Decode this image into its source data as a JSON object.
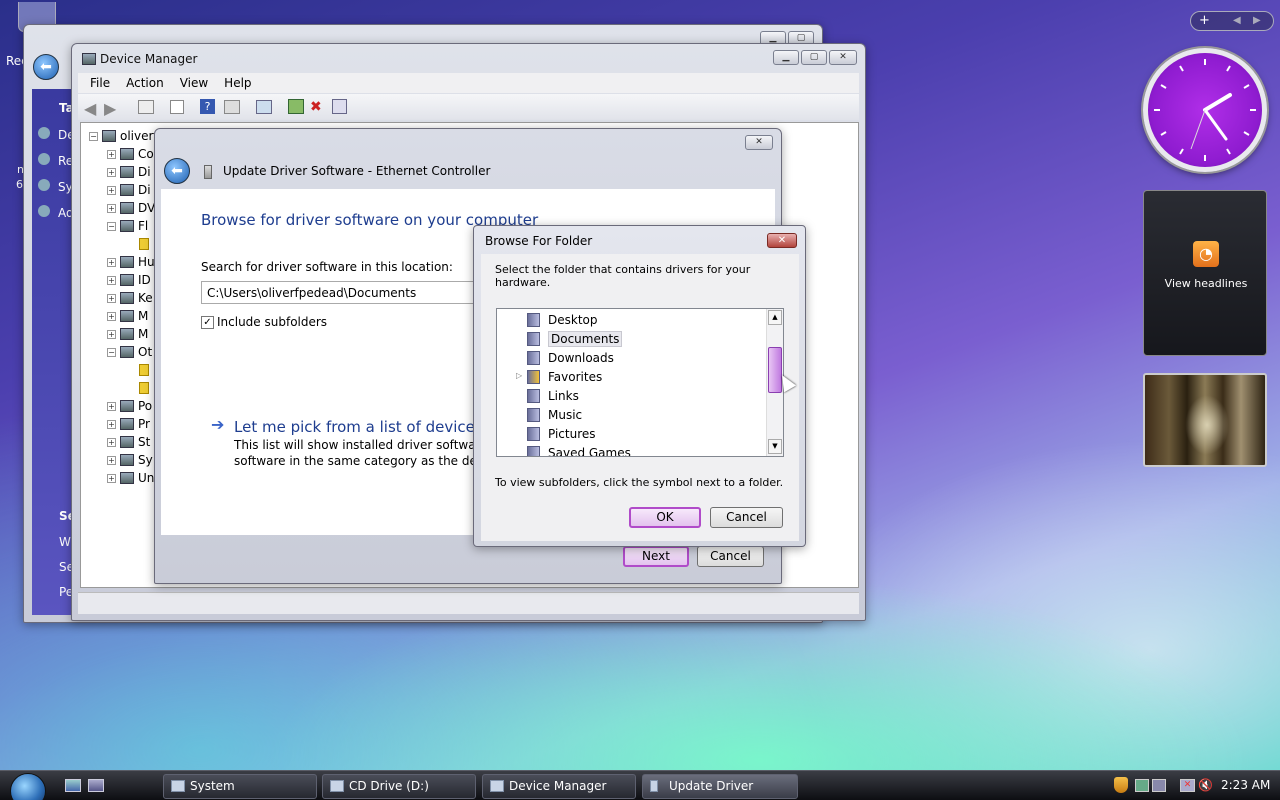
{
  "desktop": {
    "recycle_label": "Rec",
    "left_edge_text_1": "n",
    "left_edge_text_2": "6"
  },
  "system_window": {
    "tasks_heading": "Ta",
    "tasks": [
      "De",
      "Re",
      "Sy",
      "Ad"
    ],
    "see_also_heading": "Se",
    "see_also": [
      "W",
      "Se",
      "Pe"
    ]
  },
  "device_manager": {
    "title": "Device Manager",
    "menu": [
      "File",
      "Action",
      "View",
      "Help"
    ],
    "tree": {
      "root": "oliverf",
      "items": [
        "Co",
        "Di",
        "Di",
        "DV",
        "Fl",
        "",
        "Hu",
        "ID",
        "Ke",
        "M",
        "M",
        "Ot",
        "",
        "",
        "Po",
        "Pr",
        "St",
        "Sy",
        "Un"
      ]
    }
  },
  "update_driver": {
    "title": "Update Driver Software - Ethernet Controller",
    "heading": "Browse for driver software on your computer",
    "search_label": "Search for driver software in this location:",
    "path_value": "C:\\Users\\oliverfpedead\\Documents",
    "include_subfolders": "Include subfolders",
    "pick_link": "Let me pick from a list of device dri",
    "pick_desc_1": "This list will show installed driver software con",
    "pick_desc_2": "software in the same category as the device.",
    "next": "Next",
    "cancel": "Cancel"
  },
  "browse_folder": {
    "title": "Browse For Folder",
    "prompt": "Select the folder that contains drivers for your hardware.",
    "folders": [
      "Desktop",
      "Documents",
      "Downloads",
      "Favorites",
      "Links",
      "Music",
      "Pictures",
      "Saved Games"
    ],
    "selected_folder": "Documents",
    "hint": "To view subfolders, click the symbol next to a folder.",
    "ok": "OK",
    "cancel": "Cancel"
  },
  "gadgets": {
    "feed_label": "View headlines"
  },
  "taskbar": {
    "tasks": [
      "System",
      "CD Drive (D:) virtio-...",
      "Device Manager",
      "Update Driver Softw..."
    ],
    "time": "2:23 AM"
  }
}
